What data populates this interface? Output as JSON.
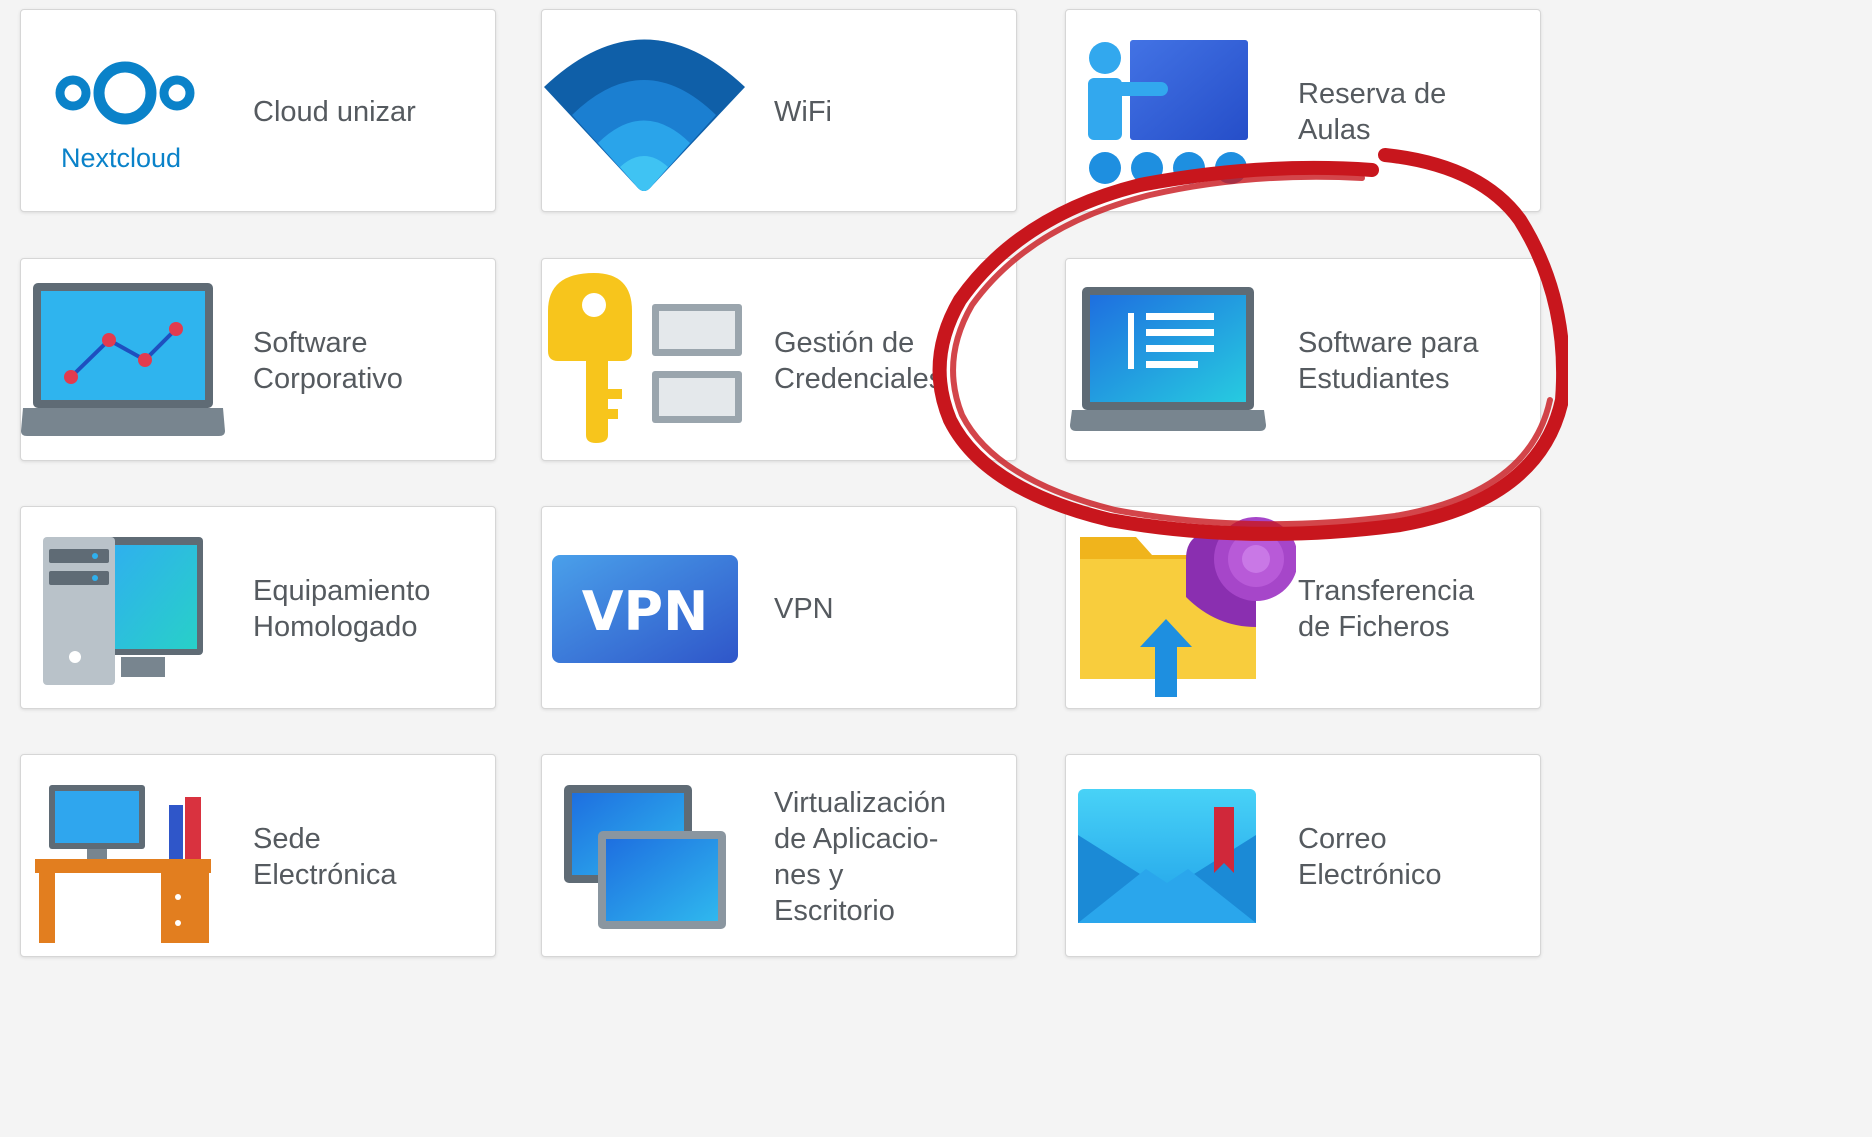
{
  "cards": [
    {
      "label": "Cloud unizar",
      "icon": "nextcloud-icon",
      "logo_text": "Nextcloud"
    },
    {
      "label": "WiFi",
      "icon": "wifi-icon"
    },
    {
      "label": "Reserva de\nAulas",
      "icon": "classroom-booking-icon"
    },
    {
      "label": "Software\nCorporativo",
      "icon": "laptop-chart-icon"
    },
    {
      "label": "Gestión de\nCredenciales",
      "icon": "key-credentials-icon"
    },
    {
      "label": "Software para\nEstudiantes",
      "icon": "laptop-document-icon"
    },
    {
      "label": "Equipamiento\nHomologado",
      "icon": "desktop-computer-icon"
    },
    {
      "label": "VPN",
      "icon": "vpn-icon",
      "logo_text": "VPN"
    },
    {
      "label": "Transferencia\nde Ficheros",
      "icon": "folder-upload-icon"
    },
    {
      "label": "Sede\nElectrónica",
      "icon": "office-desk-icon"
    },
    {
      "label": "Virtualización\nde Aplicacio-\nnes y\nEscritorio",
      "icon": "virtual-desktops-icon"
    },
    {
      "label": "Correo\nElectrónico",
      "icon": "email-icon"
    }
  ],
  "annotation": {
    "shape": "hand-drawn-circle",
    "target": "Software para\nEstudiantes",
    "color": "#c8161d"
  }
}
